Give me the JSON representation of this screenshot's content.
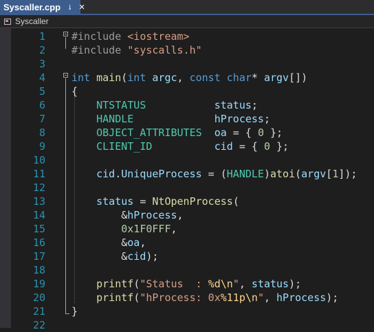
{
  "tab": {
    "title": "Syscaller.cpp",
    "pin_icon": "pin-icon",
    "close_icon": "close-icon"
  },
  "navbar": {
    "label": "Syscaller",
    "icon": "project-icon"
  },
  "colors": {
    "tab_active": "#3d5d8d",
    "background": "#1e1e1e",
    "line_number": "#2b91af",
    "keyword": "#569cd6",
    "type": "#4ec9b0",
    "string": "#d69d85",
    "number": "#b5cea8"
  },
  "code": {
    "line_numbers": [
      "1",
      "2",
      "3",
      "4",
      "5",
      "6",
      "7",
      "8",
      "9",
      "10",
      "11",
      "12",
      "13",
      "14",
      "15",
      "16",
      "17",
      "18",
      "19",
      "20",
      "21",
      "22"
    ],
    "lines": [
      [
        [
          "pp",
          "#include "
        ],
        [
          "str",
          "<iostream>"
        ]
      ],
      [
        [
          "pp",
          "#include "
        ],
        [
          "str",
          "\"syscalls.h\""
        ]
      ],
      [],
      [
        [
          "kw",
          "int"
        ],
        [
          "p",
          " "
        ],
        [
          "fn",
          "main"
        ],
        [
          "p",
          "("
        ],
        [
          "kw",
          "int"
        ],
        [
          "p",
          " "
        ],
        [
          "lv",
          "argc"
        ],
        [
          "p",
          ", "
        ],
        [
          "kw",
          "const"
        ],
        [
          "p",
          " "
        ],
        [
          "kw",
          "char"
        ],
        [
          "p",
          "* "
        ],
        [
          "lv",
          "argv"
        ],
        [
          "p",
          "[])"
        ]
      ],
      [
        [
          "p",
          "{"
        ]
      ],
      [
        [
          "p",
          "    "
        ],
        [
          "ty",
          "NTSTATUS"
        ],
        [
          "p",
          "           "
        ],
        [
          "var",
          "status"
        ],
        [
          "p",
          ";"
        ]
      ],
      [
        [
          "p",
          "    "
        ],
        [
          "ty",
          "HANDLE"
        ],
        [
          "p",
          "             "
        ],
        [
          "var",
          "hProcess"
        ],
        [
          "p",
          ";"
        ]
      ],
      [
        [
          "p",
          "    "
        ],
        [
          "ty",
          "OBJECT_ATTRIBUTES"
        ],
        [
          "p",
          "  "
        ],
        [
          "var",
          "oa"
        ],
        [
          "p",
          " = { "
        ],
        [
          "num",
          "0"
        ],
        [
          "p",
          " };"
        ]
      ],
      [
        [
          "p",
          "    "
        ],
        [
          "ty",
          "CLIENT_ID"
        ],
        [
          "p",
          "          "
        ],
        [
          "var",
          "cid"
        ],
        [
          "p",
          " = { "
        ],
        [
          "num",
          "0"
        ],
        [
          "p",
          " };"
        ]
      ],
      [],
      [
        [
          "p",
          "    "
        ],
        [
          "var",
          "cid"
        ],
        [
          "p",
          "."
        ],
        [
          "var",
          "UniqueProcess"
        ],
        [
          "p",
          " = ("
        ],
        [
          "ty",
          "HANDLE"
        ],
        [
          "p",
          ")"
        ],
        [
          "fn",
          "atoi"
        ],
        [
          "p",
          "("
        ],
        [
          "lv",
          "argv"
        ],
        [
          "p",
          "["
        ],
        [
          "num",
          "1"
        ],
        [
          "p",
          "]);"
        ]
      ],
      [],
      [
        [
          "p",
          "    "
        ],
        [
          "var",
          "status"
        ],
        [
          "p",
          " = "
        ],
        [
          "fn",
          "NtOpenProcess"
        ],
        [
          "p",
          "("
        ]
      ],
      [
        [
          "p",
          "        &"
        ],
        [
          "var",
          "hProcess"
        ],
        [
          "p",
          ","
        ]
      ],
      [
        [
          "p",
          "        "
        ],
        [
          "num",
          "0x1F0FFF"
        ],
        [
          "p",
          ","
        ]
      ],
      [
        [
          "p",
          "        &"
        ],
        [
          "var",
          "oa"
        ],
        [
          "p",
          ","
        ]
      ],
      [
        [
          "p",
          "        &"
        ],
        [
          "var",
          "cid"
        ],
        [
          "p",
          ");"
        ]
      ],
      [],
      [
        [
          "p",
          "    "
        ],
        [
          "fn",
          "printf"
        ],
        [
          "p",
          "("
        ],
        [
          "str",
          "\"Status  : "
        ],
        [
          "esc",
          "%d"
        ],
        [
          "esc",
          "\\n"
        ],
        [
          "str",
          "\""
        ],
        [
          "p",
          ", "
        ],
        [
          "var",
          "status"
        ],
        [
          "p",
          ");"
        ]
      ],
      [
        [
          "p",
          "    "
        ],
        [
          "fn",
          "printf"
        ],
        [
          "p",
          "("
        ],
        [
          "str",
          "\"hProcess: 0x"
        ],
        [
          "esc",
          "%11p"
        ],
        [
          "esc",
          "\\n"
        ],
        [
          "str",
          "\""
        ],
        [
          "p",
          ", "
        ],
        [
          "var",
          "hProcess"
        ],
        [
          "p",
          ");"
        ]
      ],
      [
        [
          "p",
          "}"
        ]
      ],
      []
    ]
  }
}
